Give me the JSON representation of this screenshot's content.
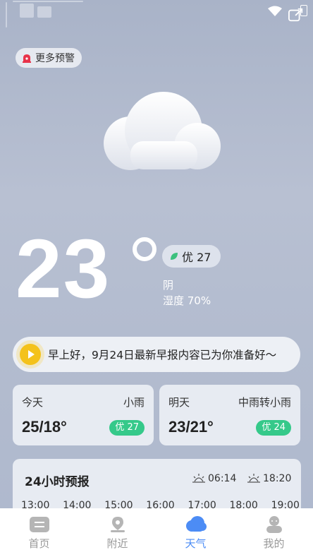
{
  "alert": {
    "label": "更多预警"
  },
  "current": {
    "temperature": "23",
    "aqi_label": "优 27",
    "condition": "阴",
    "humidity": "湿度 70%"
  },
  "morning_report": {
    "text": "早上好，9月24日最新早报内容已为你准备好～"
  },
  "today": {
    "day": "今天",
    "weather": "小雨",
    "temp": "25/18°",
    "aqi": "优 27"
  },
  "tomorrow": {
    "day": "明天",
    "weather": "中雨转小雨",
    "temp": "23/21°",
    "aqi": "优 24"
  },
  "forecast": {
    "title": "24小时预报",
    "sunrise": "06:14",
    "sunset": "18:20",
    "hours": [
      "13:00",
      "14:00",
      "15:00",
      "16:00",
      "17:00",
      "18:00",
      "19:00"
    ]
  },
  "nav": {
    "home": "首页",
    "nearby": "附近",
    "weather": "天气",
    "mine": "我的"
  },
  "colors": {
    "accent": "#4c8cf5",
    "aqi_green": "#35c98a",
    "play": "#f4c21b"
  }
}
